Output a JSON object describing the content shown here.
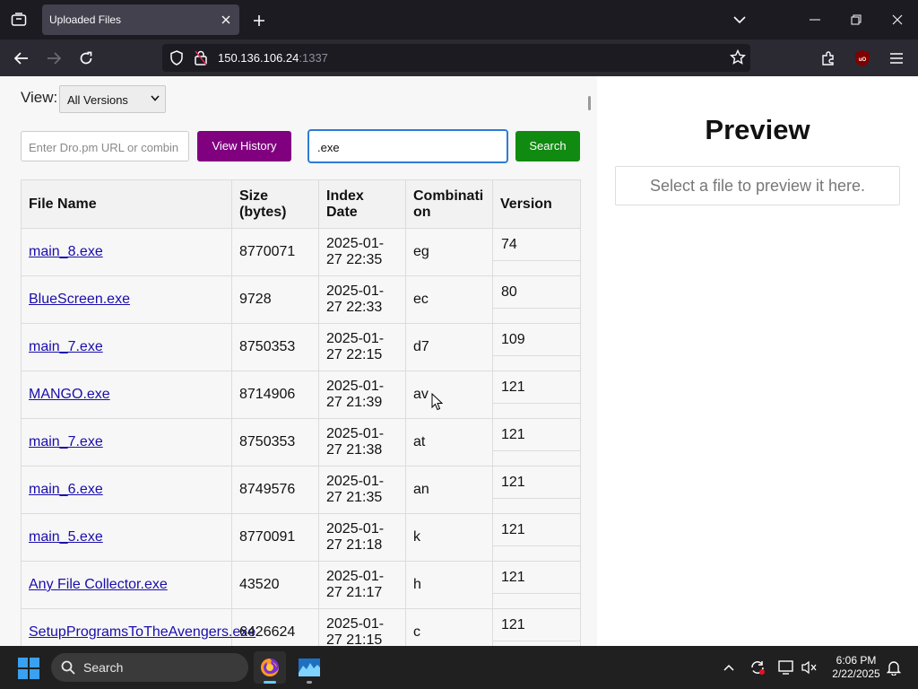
{
  "browser": {
    "tab_title": "Uploaded Files",
    "url_host": "150.136.106.24",
    "url_port": ":1337"
  },
  "controls": {
    "view_label": "View:",
    "view_select_value": "All Versions",
    "url_placeholder": "Enter Dro.pm URL or combin",
    "history_button": "View History",
    "search_value": ".exe",
    "search_button": "Search"
  },
  "table": {
    "headers": {
      "file_name": "File Name",
      "size": "Size (bytes)",
      "index_date": "Index Date",
      "combination": "Combination",
      "version": "Version"
    },
    "rows": [
      {
        "name": "main_8.exe",
        "size": "8770071",
        "date": "2025-01-27 22:35",
        "combo": "eg",
        "version": "74"
      },
      {
        "name": "BlueScreen.exe",
        "size": "9728",
        "date": "2025-01-27 22:33",
        "combo": "ec",
        "version": "80"
      },
      {
        "name": "main_7.exe",
        "size": "8750353",
        "date": "2025-01-27 22:15",
        "combo": "d7",
        "version": "109"
      },
      {
        "name": "MANGO.exe",
        "size": "8714906",
        "date": "2025-01-27 21:39",
        "combo": "av",
        "version": "121"
      },
      {
        "name": "main_7.exe",
        "size": "8750353",
        "date": "2025-01-27 21:38",
        "combo": "at",
        "version": "121"
      },
      {
        "name": "main_6.exe",
        "size": "8749576",
        "date": "2025-01-27 21:35",
        "combo": "an",
        "version": "121"
      },
      {
        "name": "main_5.exe",
        "size": "8770091",
        "date": "2025-01-27 21:18",
        "combo": "k",
        "version": "121"
      },
      {
        "name": "Any File Collector.exe",
        "size": "43520",
        "date": "2025-01-27 21:17",
        "combo": "h",
        "version": "121"
      },
      {
        "name": "SetupProgramsToTheAvengers.exe",
        "size": "6426624",
        "date": "2025-01-27 21:15",
        "combo": "c",
        "version": "121"
      }
    ]
  },
  "preview": {
    "title": "Preview",
    "placeholder": "Select a file to preview it here."
  },
  "taskbar": {
    "search_label": "Search",
    "time": "6:06 PM",
    "date": "2/22/2025"
  },
  "colors": {
    "history_button": "#800080",
    "search_button": "#108a10",
    "search_focus": "#2e7bd6",
    "link": "#1a0dab"
  },
  "icons": [
    "tab-list-icon",
    "close-icon",
    "plus-icon",
    "chevron-down-icon",
    "minimize-icon",
    "restore-icon",
    "back-icon",
    "forward-icon",
    "reload-icon",
    "shield-icon",
    "lock-icon",
    "star-icon",
    "extensions-icon",
    "ublock-icon",
    "menu-icon",
    "windows-icon",
    "search-icon",
    "firefox-icon",
    "chart-app-icon",
    "chevron-up-icon",
    "sync-icon",
    "display-icon",
    "volume-muted-icon",
    "bell-icon"
  ]
}
